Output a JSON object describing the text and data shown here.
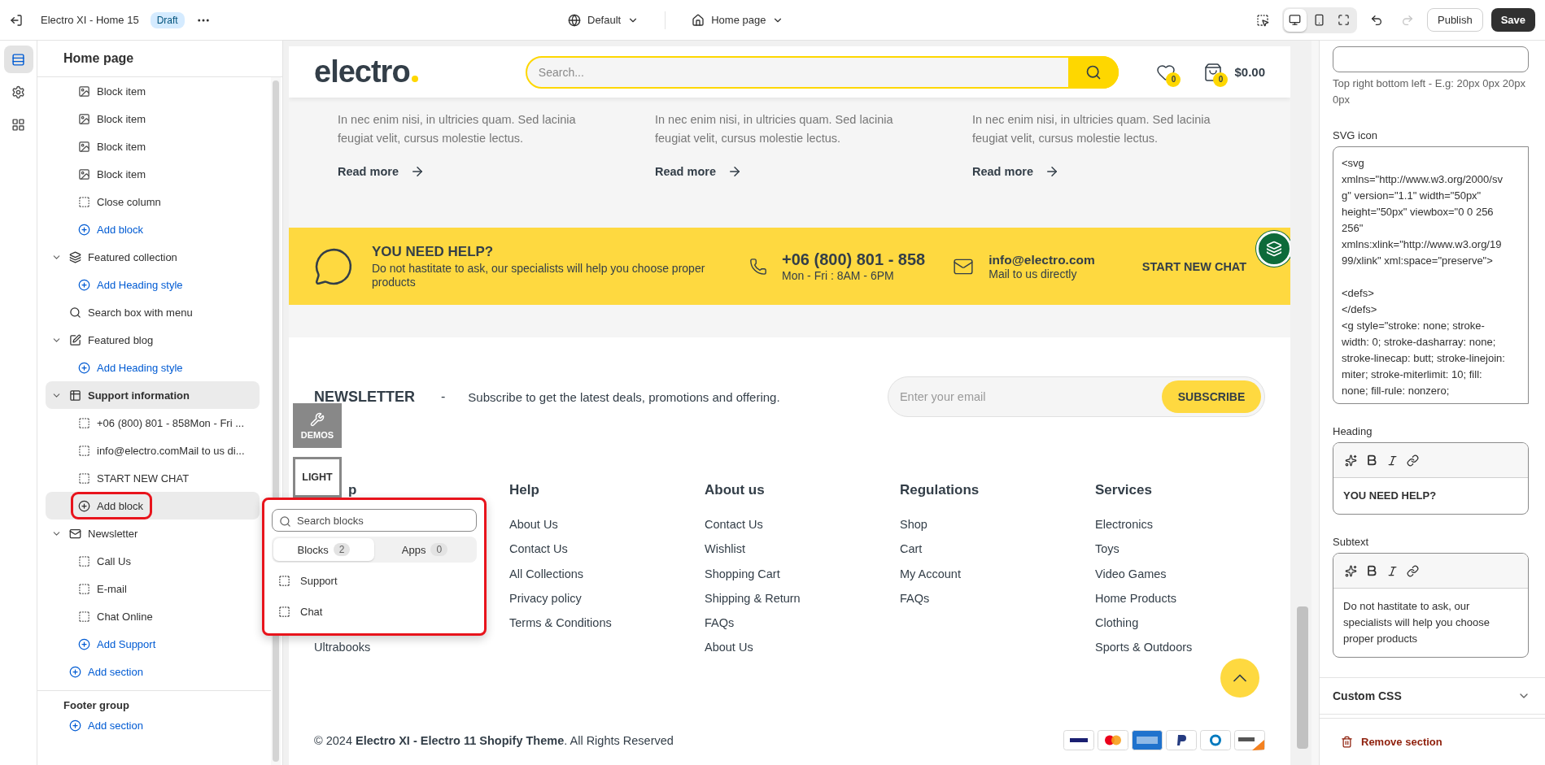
{
  "topbar": {
    "title": "Electro XI - Home 15",
    "badge": "Draft",
    "theme": "Default",
    "page": "Home page",
    "devices": [
      {
        "selected": true
      },
      {
        "selected": false
      },
      {
        "selected": false
      }
    ],
    "publish": "Publish",
    "save": "Save"
  },
  "rail": [
    {
      "selected": true
    },
    {
      "selected": false
    },
    {
      "selected": false
    }
  ],
  "sidebar": {
    "title": "Home page",
    "continued_children": [
      {
        "kind": "item",
        "label": "Block item"
      },
      {
        "kind": "item",
        "label": "Block item"
      },
      {
        "kind": "item",
        "label": "Block item"
      },
      {
        "kind": "item",
        "label": "Block item"
      },
      {
        "kind": "block",
        "label": "Close column"
      },
      {
        "kind": "add",
        "label": "Add block",
        "selected": false
      }
    ],
    "sections": [
      {
        "kind": "section",
        "label": "Featured collection",
        "expanded": true,
        "selected": false,
        "children": [
          {
            "kind": "add",
            "label": "Add Heading style",
            "selected": false
          }
        ]
      },
      {
        "kind": "section",
        "label": "Search box with menu",
        "selected": false
      },
      {
        "kind": "section",
        "label": "Featured blog",
        "expanded": true,
        "selected": false,
        "children": [
          {
            "kind": "add",
            "label": "Add Heading style",
            "selected": false
          }
        ]
      },
      {
        "kind": "section",
        "label": "Support information",
        "expanded": true,
        "selected": true,
        "children": [
          {
            "kind": "block",
            "label": "+06 (800) 801 - 858Mon - Fri ..."
          },
          {
            "kind": "block",
            "label": "info@electro.comMail to us di..."
          },
          {
            "kind": "block",
            "label": "START NEW CHAT"
          },
          {
            "kind": "add",
            "label": "Add block",
            "selected": true
          }
        ]
      },
      {
        "kind": "section",
        "label": "Newsletter",
        "expanded": true,
        "selected": false,
        "children": [
          {
            "kind": "block",
            "label": "Call Us"
          },
          {
            "kind": "block",
            "label": "E-mail"
          },
          {
            "kind": "block",
            "label": "Chat Online"
          },
          {
            "kind": "add",
            "label": "Add Support",
            "selected": false
          }
        ]
      },
      {
        "kind": "add",
        "label": "Add section",
        "selected": false
      }
    ],
    "footer_group": {
      "title": "Footer group",
      "add": "Add section"
    }
  },
  "popover": {
    "search_placeholder": "Search blocks",
    "tabs": [
      {
        "label": "Blocks",
        "count": "2",
        "selected": true
      },
      {
        "label": "Apps",
        "count": "0",
        "selected": false
      }
    ],
    "items": [
      "Support",
      "Chat"
    ]
  },
  "preview": {
    "header": {
      "logo": "electro",
      "search_placeholder": "Search...",
      "wishlist_count": "0",
      "cart_count": "0",
      "cart_total": "$0.00"
    },
    "posts": [
      {
        "excerpt": "In nec enim nisi, in ultricies quam. Sed lacinia feugiat velit, cursus molestie lectus.",
        "link": "Read more"
      },
      {
        "excerpt": "In nec enim nisi, in ultricies quam. Sed lacinia feugiat velit, cursus molestie lectus.",
        "link": "Read more"
      },
      {
        "excerpt": "In nec enim nisi, in ultricies quam. Sed lacinia feugiat velit, cursus molestie lectus.",
        "link": "Read more"
      }
    ],
    "help": {
      "heading": "YOU NEED HELP?",
      "subtext": "Do not hastitate to ask, our specialists will help you choose proper products",
      "phone": "+06 (800) 801 - 858",
      "hours": "Mon - Fri : 8AM - 6PM",
      "email": "info@electro.com",
      "email_note": "Mail to us directly",
      "chat": "START NEW CHAT"
    },
    "newsletter": {
      "title": "NEWSLETTER",
      "dash": "-",
      "text": "Subscribe to get the latest deals, promotions and offering.",
      "placeholder": "Enter your email",
      "button": "SUBSCRIBE"
    },
    "floating": {
      "demos": "DEMOS",
      "light": "LIGHT"
    },
    "columns": [
      {
        "heading": "p",
        "links": [
          "Ultrabooks"
        ]
      },
      {
        "heading": "Help",
        "links": [
          "About Us",
          "Contact Us",
          "All Collections",
          "Privacy policy",
          "Terms & Conditions"
        ]
      },
      {
        "heading": "About us",
        "links": [
          "Contact Us",
          "Wishlist",
          "Shopping Cart",
          "Shipping & Return",
          "FAQs",
          "About Us"
        ]
      },
      {
        "heading": "Regulations",
        "links": [
          "Shop",
          "Cart",
          "My Account",
          "FAQs"
        ]
      },
      {
        "heading": "Services",
        "links": [
          "Electronics",
          "Toys",
          "Video Games",
          "Home Products",
          "Clothing",
          "Sports & Outdoors"
        ]
      }
    ],
    "copyright": "© 2024 **Electro XI - Electro 11 Shopify Theme**. All Rights Reserved"
  },
  "settings": {
    "padding_hint": "Top right bottom left - E.g: 20px 0px 20px 0px",
    "svg_label": "SVG icon",
    "svg_value": "<svg xmlns=\"http://www.w3.org/2000/svg\" version=\"1.1\" width=\"50px\" height=\"50px\" viewbox=\"0 0 256 256\" xmlns:xlink=\"http://www.w3.org/1999/xlink\" xml:space=\"preserve\">\n\n<defs>\n</defs>\n<g style=\"stroke: none; stroke-width: 0; stroke-dasharray: none; stroke-linecap: butt; stroke-linejoin: miter; stroke-miterlimit: 10; fill: none; fill-rule: nonzero;",
    "editors": [
      {
        "label": "Heading",
        "value": "YOU NEED HELP?",
        "bold": true
      },
      {
        "label": "Subtext",
        "value": "Do not hastitate to ask, our specialists will help you choose proper products",
        "bold": false
      }
    ],
    "custom_css": {
      "label": "Custom CSS",
      "expanded": false
    },
    "remove": "Remove section"
  }
}
